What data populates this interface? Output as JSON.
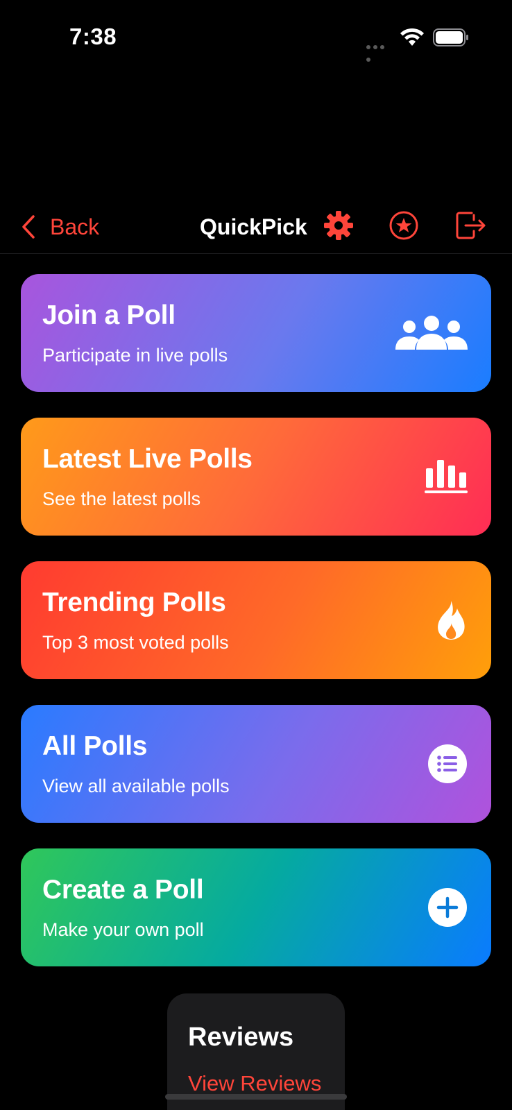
{
  "status_bar": {
    "time": "7:38"
  },
  "nav": {
    "back_label": "Back",
    "title": "QuickPick",
    "icons": [
      "gear-icon",
      "star-circle-icon",
      "logout-icon"
    ],
    "accent_color": "#ff453a"
  },
  "cards": [
    {
      "title": "Join a Poll",
      "subtitle": "Participate in live polls",
      "icon": "people-group-icon"
    },
    {
      "title": "Latest Live Polls",
      "subtitle": "See the latest polls",
      "icon": "bar-chart-icon"
    },
    {
      "title": "Trending Polls",
      "subtitle": "Top 3 most voted polls",
      "icon": "flame-icon"
    },
    {
      "title": "All Polls",
      "subtitle": "View all available polls",
      "icon": "list-circle-icon"
    },
    {
      "title": "Create a Poll",
      "subtitle": "Make your own poll",
      "icon": "plus-circle-icon"
    }
  ],
  "reviews": {
    "title": "Reviews",
    "link": "View Reviews"
  }
}
